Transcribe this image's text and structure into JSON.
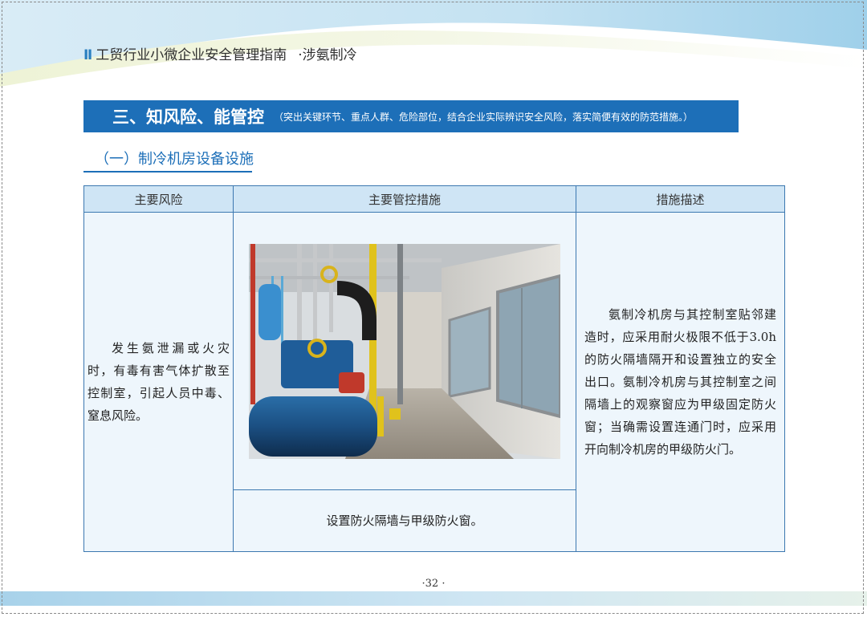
{
  "header": {
    "marker": "Ⅱ",
    "guide_title": "工贸行业小微企业安全管理指南",
    "module": "·涉氨制冷"
  },
  "section": {
    "title": "三、知风险、能管控",
    "note": "（突出关键环节、重点人群、危险部位，结合企业实际辨识安全风险，落实简便有效的防范措施。）"
  },
  "subsection": {
    "title": "（一）制冷机房设备设施"
  },
  "table": {
    "headers": [
      "主要风险",
      "主要管控措施",
      "措施描述"
    ],
    "risk": "发生氨泄漏或火灾时，有毒有害气体扩散至控制室，引起人员中毒、窒息风险。",
    "measure_caption": "设置防火隔墙与甲级防火窗。",
    "description": "氨制冷机房与其控制室贴邻建造时，应采用耐火极限不低于3.0h 的防火隔墙隔开和设置独立的安全出口。氨制冷机房与其控制室之间隔墙上的观察窗应为甲级固定防火窗；当确需设置连通门时，应采用开向制冷机房的甲级防火门。"
  },
  "footer": {
    "page_number": "·32 ·"
  },
  "colors": {
    "banner": "#1d6fb8",
    "header_cell": "#cfe5f5",
    "body_cell": "#eef6fc",
    "border": "#3c78b0"
  }
}
